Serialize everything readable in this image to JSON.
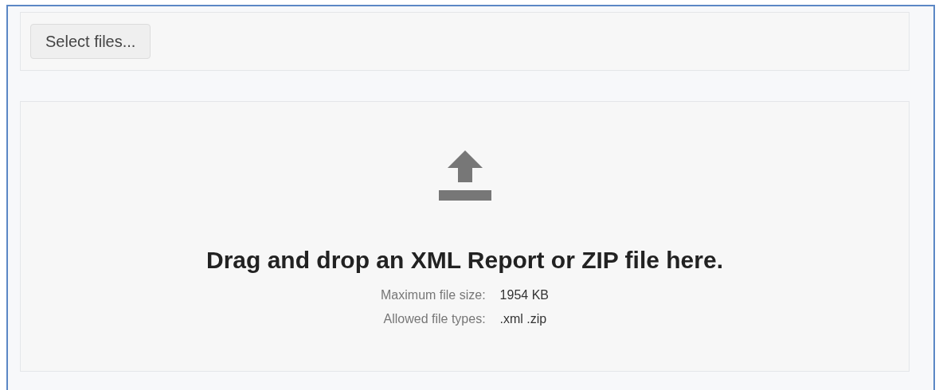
{
  "toolbar": {
    "button": "Select files..."
  },
  "dropzone": {
    "heading": "Drag and drop an XML Report or ZIP file here.",
    "info": [
      {
        "label": "Maximum file size:",
        "value": "1954 KB"
      },
      {
        "label": "Allowed file types:",
        "value": ".xml .zip"
      }
    ]
  }
}
